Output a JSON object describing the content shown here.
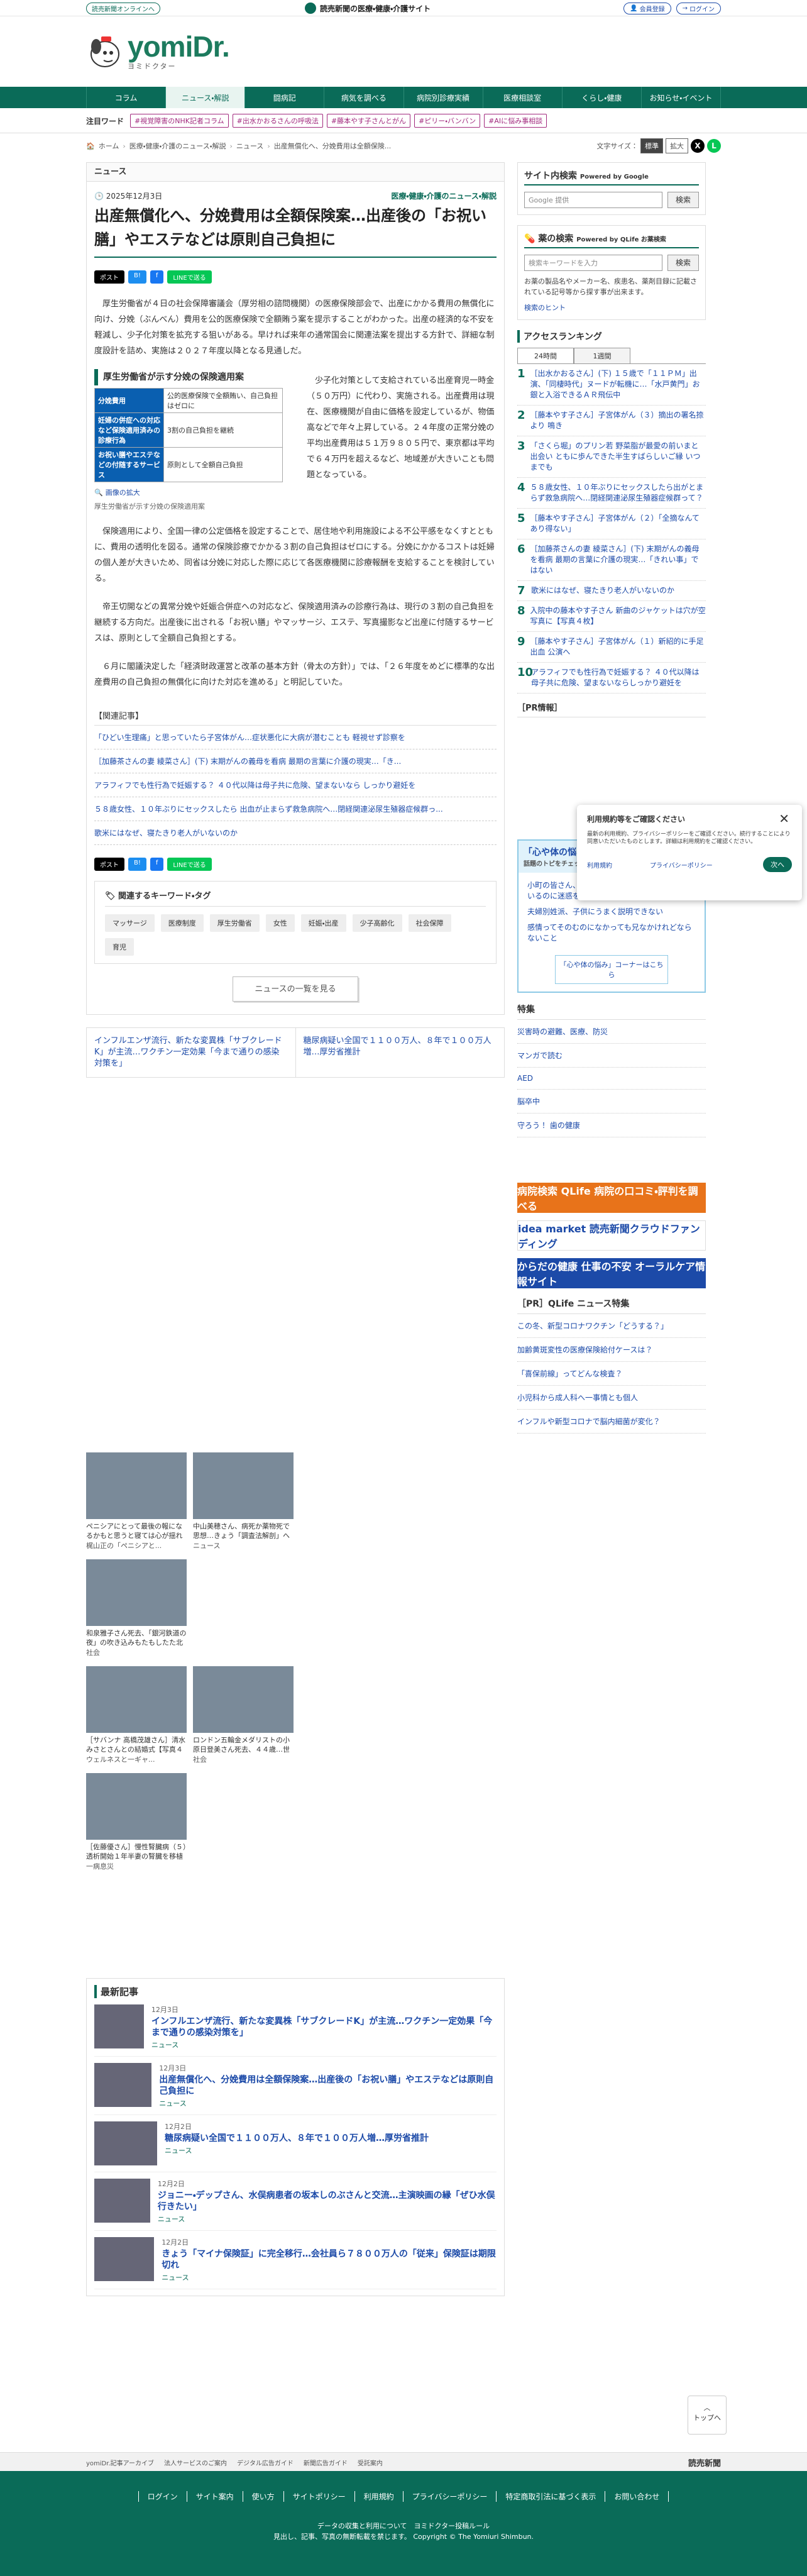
{
  "topbar": {
    "online": "読売新聞オンラインへ",
    "tagline": "読売新聞の医療・健康・介護サイト",
    "register": "会員登録",
    "login": "ログイン"
  },
  "logo": {
    "main": "yomiDr.",
    "sub": "ヨミドクター"
  },
  "nav": [
    "コラム",
    "ニュース・解説",
    "闘病記",
    "病気を調べる",
    "病院別診療実績",
    "医療相談室",
    "くらし・健康",
    "お知らせ・イベント"
  ],
  "attn": {
    "label": "注目ワード",
    "tags": [
      "#視覚障害のNHK記者コラム",
      "#出水かおるさんの呼吸法",
      "#藤本やす子さんとがん",
      "#ピリー・バンバン",
      "#AIに悩み事相談"
    ]
  },
  "crumbs": {
    "items": [
      "ホーム",
      "医療・健康・介護のニュース・解説",
      "ニュース",
      "出産無償化へ、分娩費用は全額保険..."
    ],
    "fsize": "文字サイズ：",
    "std": "標準",
    "large": "拡大"
  },
  "article": {
    "section": "ニュース",
    "date": "2025年12月3日",
    "category": "医療・健康・介護のニュース・解説",
    "headline": "出産無償化へ、分娩費用は全額保険案…出産後の「お祝い膳」やエステなどは原則自己負担に",
    "share": {
      "post": "ポスト",
      "b": "B!",
      "fb": "f",
      "line": "LINEで送る"
    },
    "p1": "厚生労働省が４日の社会保障審議会（厚労相の諮問機関）の医療保険部会で、出産にかかる費用の無償化に向け、分娩（ぶんべん）費用を公的医療保険で全額賄う案を提示することがわかった。出産の経済的な不安を軽減し、少子化対策を拡充する狙いがある。早ければ来年の通常国会に関連法案を提出する方針で、詳細な制度設計を詰め、実施は２０２７年度以降となる見通しだ。",
    "fig": {
      "title": "厚生労働省が示す分娩の保険適用案",
      "rows": [
        [
          "分娩費用",
          "公的医療保険で全額賄い、自己負担はゼロに"
        ],
        [
          "妊婦の併症への対応など保険適用済みの診療行為",
          "3割の自己負担を継続"
        ],
        [
          "お祝い膳やエステなどの付随するサービス",
          "原則として全額自己負担"
        ]
      ],
      "zoom": "画像の拡大",
      "caption": "厚生労働省が示す分娩の保険適用案"
    },
    "p2": "少子化対策として支給されている出産育児一時金（５０万円）に代わり、実施される。出産費用は現在、医療機関が自由に価格を設定しているが、物価高などで年々上昇している。２４年度の正常分娩の平均出産費用は５１万９８０５円で、東京都は平均で６４万円を超えるなど、地域差が大きいことも問題となっている。",
    "p3": "保険適用により、全国一律の公定価格を設定することで、居住地や利用施設による不公平感をなくすとともに、費用の透明化を図る。通常の保険診療でかかる３割の自己負担はゼロにする。分娩にかかるコストは妊婦の個人差が大きいため、同省は分娩に対応した際に応じて各医療機関に診療報酬を支給することを検討している。",
    "p4": "帝王切開などの異常分娩や妊娠合併症への対応など、保険適用済みの診療行為は、現行の３割の自己負担を継続する方向だ。出産後に出される「お祝い膳」やマッサージ、エステ、写真撮影など出産に付随するサービスは、原則として全額自己負担とする。",
    "p5": "６月に閣議決定した「経済財政運営と改革の基本方針（骨太の方針）」では、「２６年度をめどに標準的な出産費用の自己負担の無償化に向けた対応を進める」と明記していた。",
    "related": {
      "h": "【関連記事】",
      "items": [
        "「ひどい生理痛」と思っていたら子宮体がん…症状悪化に大病が潜むことも 軽視せず診察を",
        "［加藤茶さんの妻 綾菜さん］(下) 末期がんの義母を看病 最期の言葉に介護の現実…「き...",
        "アラフィフでも性行為で妊娠する？ ４０代以降は母子共に危険、望まないなら しっかり避妊を",
        "５８歳女性、１０年ぶりにセックスしたら 出血が止まらず救急病院へ…閉経関連泌尿生殖器症候群っ...",
        "歌米にはなぜ、寝たきり老人がいないのか"
      ]
    },
    "kw": {
      "h": "関連するキーワード・タグ",
      "items": [
        "マッサージ",
        "医療制度",
        "厚生労働省",
        "女性",
        "妊娠・出産",
        "少子高齢化",
        "社会保障",
        "育児"
      ]
    },
    "more": "ニュースの一覧を見る",
    "prev": "インフルエンザ流行、新たな変異株「サブクレードK」が主流…ワクチン一定効果「今まで通りの感染対策を」",
    "next": "糖尿病疑い全国で１１００万人、８年で１００万人増…厚労省推計"
  },
  "side": {
    "search": {
      "h": "サイト内検索",
      "by": "Powered by Google",
      "ph": "Google 提供",
      "btn": "検索"
    },
    "drug": {
      "h": "薬の検索",
      "by": "Powered by QLife お薬検索",
      "ph": "検索キーワードを入力",
      "btn": "検索",
      "note": "お薬の製品名やメーカー名、疾患名、薬剤目録に記載されている記号等から探す事が出来ます。",
      "hint": "検索のヒント"
    },
    "rank": {
      "h": "アクセスランキング",
      "tabs": [
        "24時間",
        "1週間"
      ],
      "items": [
        "［出水かおるさん］(下) １５歳で「１１ＰＭ」出演、「同棲時代」ヌードが転機に…「水戸黄門」お銀と入浴できるＡＲ飛伝中",
        "［藤本やす子さん］子宮体がん（３）摘出の署名捺より 鳴き",
        "「さくら堀」のプリン若 野菜脂が最愛の前いまと出会い ともに歩んできた半生すばらしいご縁 いつまでも",
        "５８歳女性、１０年ぶりにセックスしたら出がとまらず救急病院へ…閉経関連泌尿生殖器症候群って？",
        "［藤本やす子さん］子宮体がん（２）「全摘なんてあり得ない」",
        "［加藤茶さんの妻 綾菜さん］(下) 末期がんの義母を看病 最期の言葉に介護の現実…「きれい事」ではない",
        "歌米にはなぜ、寝たきり老人がいないのか",
        "入院中の藤本やす子さん 新曲のジャケットは穴が空写真に【写真４枚】",
        "［藤本やす子さん］子宮体がん（１）新紹的に手足出血 公演へ",
        "アラフィフでも性行為で妊娠する？ ４０代以降は母子共に危険、望まないならしっかり避妊を"
      ]
    },
    "pr": "［PR情報］",
    "kokoro": {
      "h": "「心や体の悩み」コーナー",
      "sub": "話題のトピをチェック！",
      "items": [
        "小町の皆さん、助けてください（職一杯頭張っているのに迷惑をかけてしまう）",
        "夫婦別姓派、子供にうまく説明できない",
        "感情ってそのむのになかっても兄なかけれどならないこと"
      ],
      "btn": "「心や体の悩み」コーナーはこちら"
    },
    "toku": {
      "h": "特集",
      "items": [
        "災害時の避難、医療、防災",
        "マンガで読む",
        "AED",
        "脳卒中",
        "守ろう！ 歯の健康"
      ]
    },
    "banners": [
      "病院検索 QLife 病院の口コミ・評判を調べる",
      "idea market 読売新聞クラウドファンディング",
      "からだの健康 仕事の不安 オーラルケア情報サイト"
    ],
    "prq": {
      "h": "［PR］QLife ニュース特集",
      "items": [
        "この冬、新型コロナワクチン「どうする？」",
        "加齢黄斑変性の医療保険給付ケースは？",
        "「喜保前線」ってどんな検査？",
        "小児科から成人科へ一事情とも個人",
        "インフルや新型コロナで脳内細菌が変化？"
      ]
    }
  },
  "photos": [
    {
      "t": "ペニシアにとって最後の報になるかもと思うと寝ては心が揺れなかった...",
      "s": "梶山正の「ペニシアと..."
    },
    {
      "t": "中山美穂さん、病死か薬物死で思想…きょう「調査法解剖」へ",
      "s": "ニュース"
    },
    {
      "t": "和泉雅子さん死去、「銀河鉄道の夜」の吹き込みもたもしたた北海小鳥…",
      "s": "社会"
    },
    {
      "t": "",
      "s": ""
    },
    {
      "t": "［サバンナ 高橋茂雄さん］清水みさとさんとの結婚式【写真４枚】",
      "s": "ウェルネスと一ギャ..."
    },
    {
      "t": "ロンドン五輪金メダリストの小原日登美さん死去、４４歳…世界選手...",
      "s": "社会"
    },
    {
      "t": "［佐藤優さん］慢性腎臓病（５）透析開始１年半妻の腎臓を移植 闘病...",
      "s": "一病息災"
    }
  ],
  "latest": {
    "h": "最新記事",
    "items": [
      {
        "d": "12月3日",
        "t": "インフルエンザ流行、新たな変異株「サブクレードK」が主流…ワクチン一定効果「今まで通りの感染対策を」",
        "c": "ニュース"
      },
      {
        "d": "12月3日",
        "t": "出産無償化へ、分娩費用は全額保険案…出産後の「お祝い膳」やエステなどは原則自己負担に",
        "c": "ニュース"
      },
      {
        "d": "12月2日",
        "t": "糖尿病疑い全国で１１００万人、８年で１００万人増…厚労省推計",
        "c": "ニュース"
      },
      {
        "d": "12月2日",
        "t": "ジョニー・デップさん、水俣病患者の坂本しのぶさんと交流…主演映画の縁「ぜひ水俣行きたい」",
        "c": "ニュース"
      },
      {
        "d": "12月2日",
        "t": "きょう「マイナ保険証」に完全移行…会社員ら７８００万人の「従来」保険証は期限切れ",
        "c": "ニュース"
      }
    ]
  },
  "top_btn": "トップへ",
  "foot_top": [
    "yomiDr.記事アーカイブ",
    "法人サービスのご案内",
    "デジタル広告ガイド",
    "新聞広告ガイド",
    "受託案内"
  ],
  "foot_brand": "読売新聞",
  "foot_links": [
    "ログイン",
    "サイト案内",
    "使い方",
    "サイトポリシー",
    "利用規約",
    "プライバシーポリシー",
    "特定商取引法に基づく表示",
    "お問い合わせ"
  ],
  "foot_copy1": "データの収集と利用について　ヨミドクター投稿ルール",
  "foot_copy2": "見出し、記事、写真の無断転載を禁じます。 Copyright © The Yomiuri Shimbun.",
  "popup": {
    "h": "利用規約等をご確認ください",
    "body": "最新の利用規約、プライバシーポリシーをご確認ください。続行することにより同意いただいたものとします。詳細は利用規約をご確認ください。",
    "terms": "利用規約",
    "privacy": "プライバシーポリシー",
    "ok": "次へ"
  },
  "colors": {
    "brand": "#0a6b58",
    "link": "#1c4aa8",
    "tag": "#a22a7e"
  }
}
